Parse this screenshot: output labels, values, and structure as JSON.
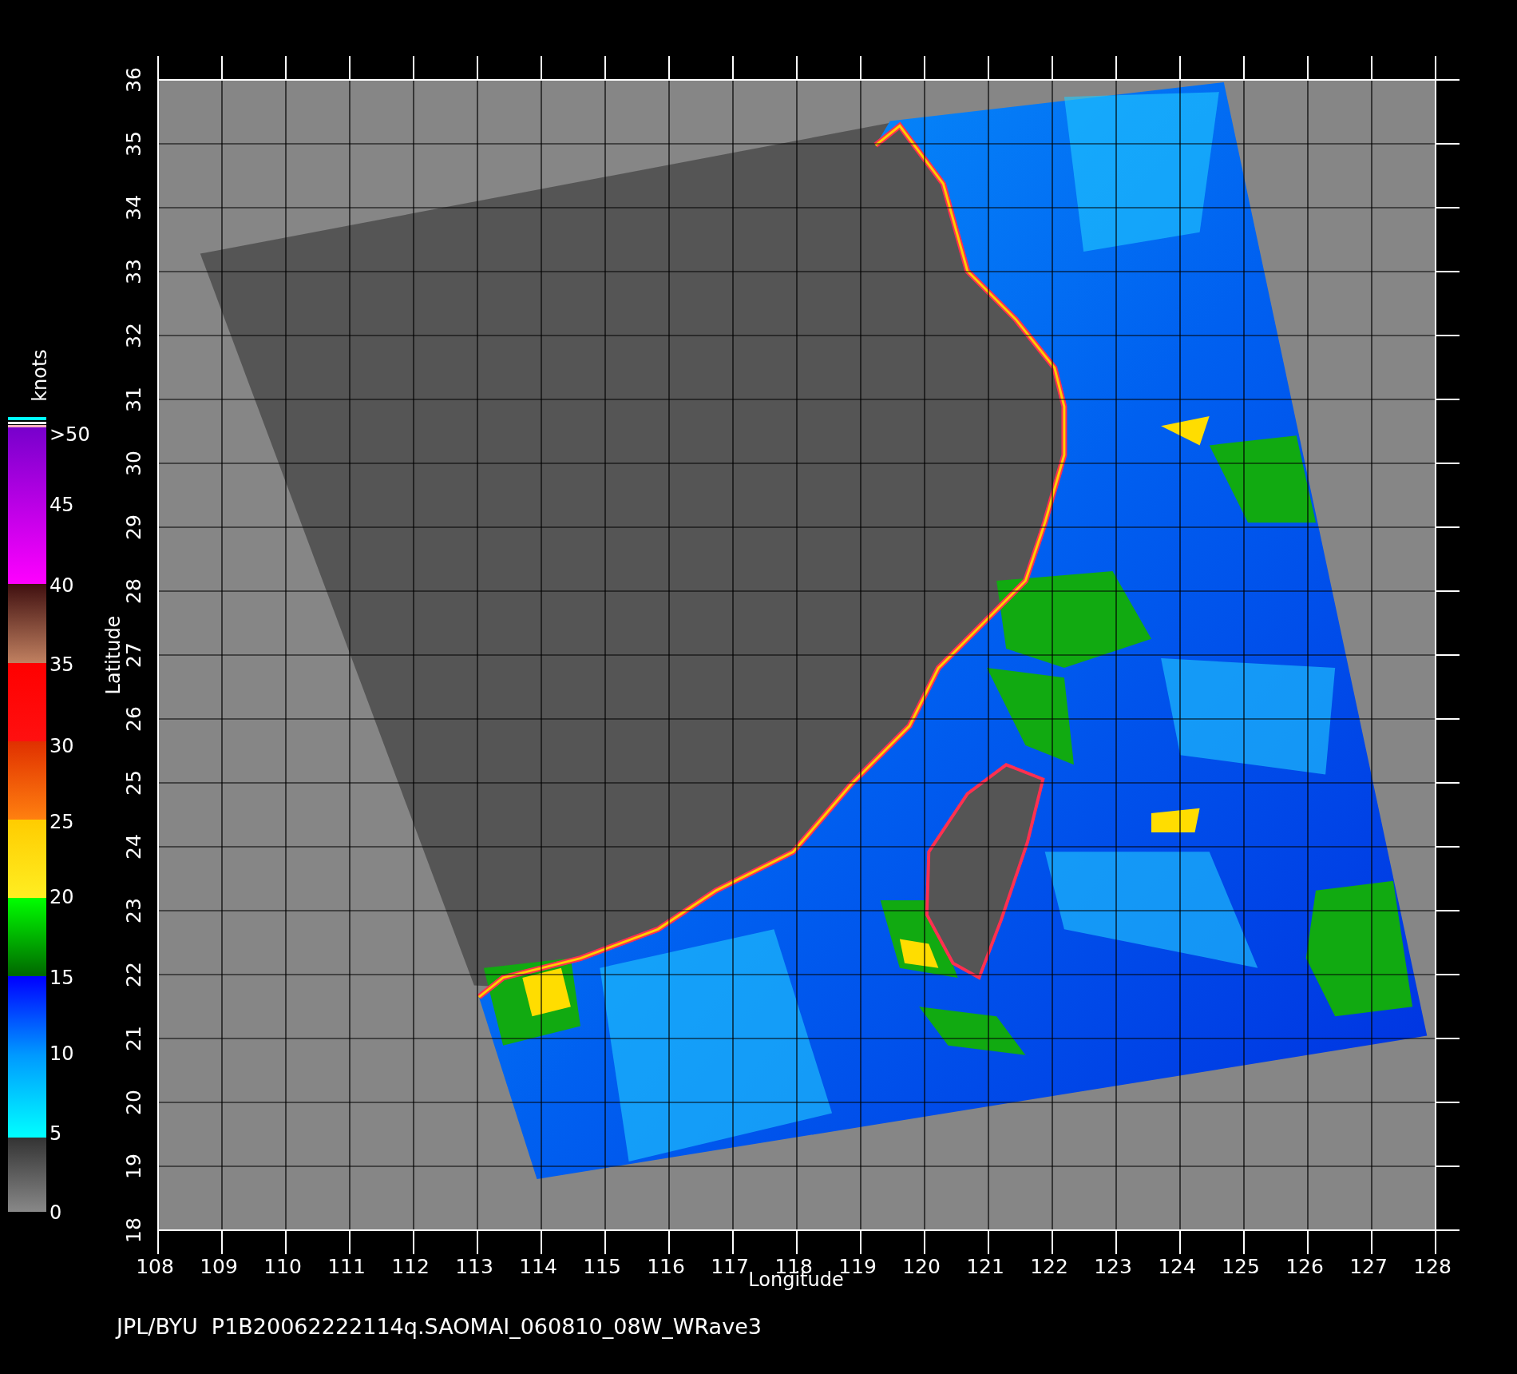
{
  "plot": {
    "xlabel": "Longitude",
    "ylabel": "Latitude",
    "xticks": [
      "108",
      "109",
      "110",
      "111",
      "112",
      "113",
      "114",
      "115",
      "116",
      "117",
      "118",
      "119",
      "120",
      "121",
      "122",
      "123",
      "124",
      "125",
      "126",
      "127",
      "128"
    ],
    "yticks": [
      "18",
      "19",
      "20",
      "21",
      "22",
      "23",
      "24",
      "25",
      "26",
      "27",
      "28",
      "29",
      "30",
      "31",
      "32",
      "33",
      "34",
      "35",
      "36"
    ]
  },
  "colorbar": {
    "unit": "knots",
    "labels": [
      ">50",
      "45",
      "40",
      "35",
      "30",
      "25",
      "20",
      "15",
      "10",
      "5",
      "0"
    ]
  },
  "footer": "JPL/BYU  P1B20062222114q.SAOMAI_060810_08W_WRave3"
}
